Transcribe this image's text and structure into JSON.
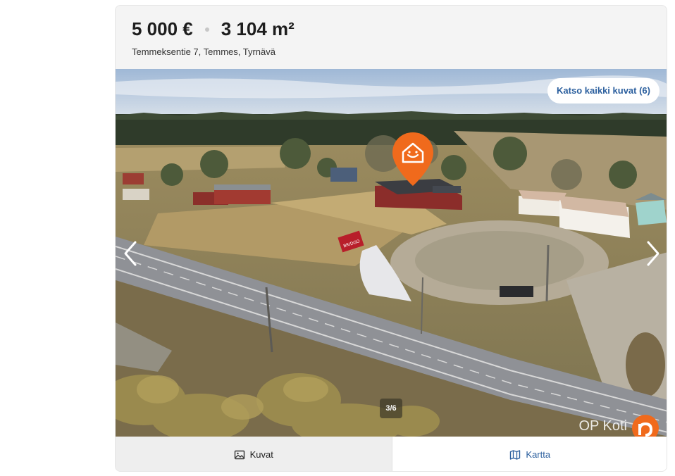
{
  "listing": {
    "price": "5 000 €",
    "area": "3 104 m²",
    "address": "Temmeksentie 7, Temmes, Tyrnävä"
  },
  "gallery": {
    "all_photos_label": "Katso kaikki kuvat (6)",
    "counter": "3/6",
    "watermark": "OP Koti",
    "sign_text": "BRIDGO"
  },
  "tabs": [
    {
      "label": "Kuvat",
      "icon": "image-icon"
    },
    {
      "label": "Kartta",
      "icon": "map-icon"
    }
  ],
  "colors": {
    "accent_blue": "#2b5f9e",
    "pin_orange": "#f06a1c",
    "card_bg": "#f4f4f4"
  }
}
